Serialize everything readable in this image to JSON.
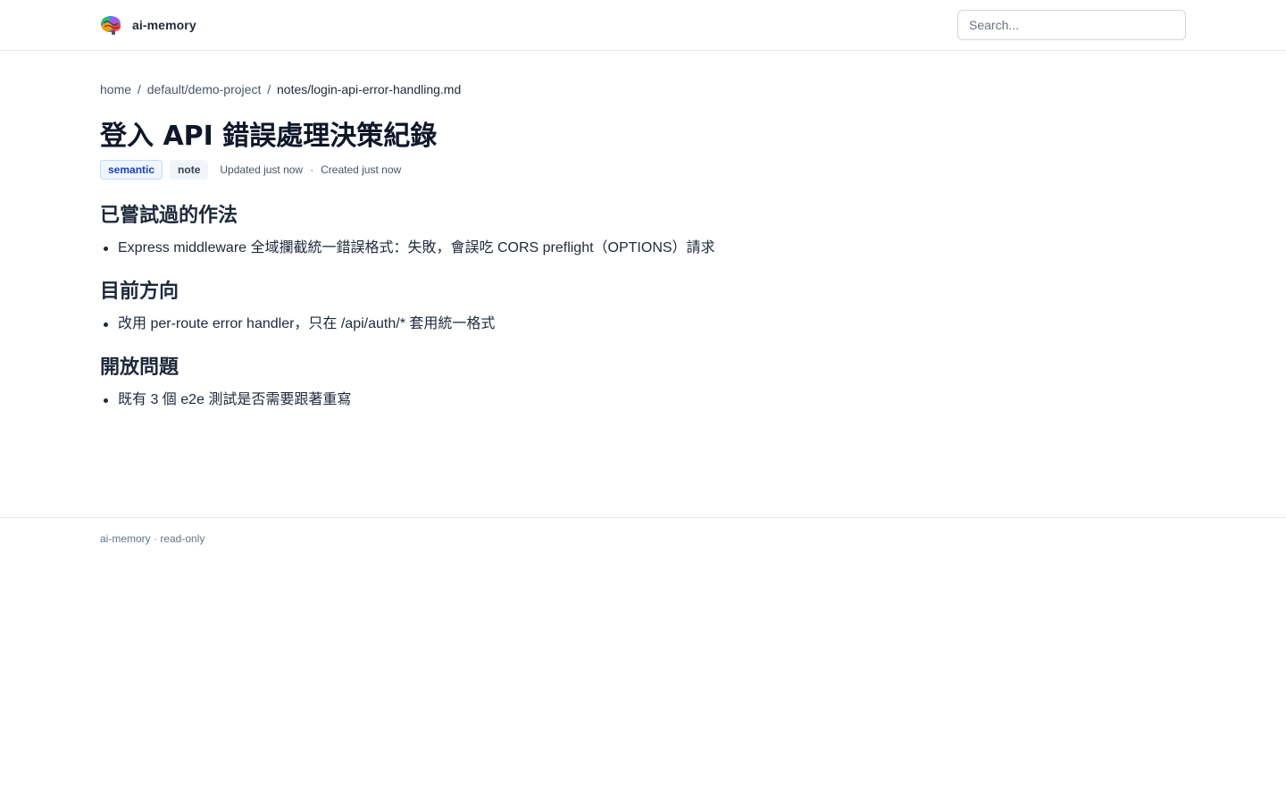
{
  "header": {
    "brand_name": "ai-memory",
    "logo_icon": "brain-icon",
    "search": {
      "placeholder": "Search...",
      "value": ""
    }
  },
  "breadcrumb": {
    "items": [
      "home",
      "default/demo-project",
      "notes/login-api-error-handling.md"
    ],
    "separator": "/"
  },
  "page": {
    "title": "登入 API 錯誤處理決策紀錄",
    "badges": {
      "type": "semantic",
      "kind": "note"
    },
    "updated": "Updated just now",
    "meta_separator": "·",
    "created": "Created just now"
  },
  "sections": [
    {
      "heading": "已嘗試過的作法",
      "items": [
        "Express middleware 全域攔截統一錯誤格式：失敗，會誤吃 CORS preflight（OPTIONS）請求"
      ]
    },
    {
      "heading": "目前方向",
      "items": [
        "改用 per-route error handler，只在 /api/auth/* 套用統一格式"
      ]
    },
    {
      "heading": "開放問題",
      "items": [
        "既有 3 個 e2e 測試是否需要跟著重寫"
      ]
    }
  ],
  "footer": {
    "text": "ai-memory · read-only"
  },
  "colors": {
    "accent": "#1e40af",
    "badge_type_bg": "#eff6ff",
    "badge_kind_bg": "#f1f5f9",
    "text_primary": "#1e293b",
    "text_muted": "#64748b",
    "border": "#e5e7eb"
  }
}
